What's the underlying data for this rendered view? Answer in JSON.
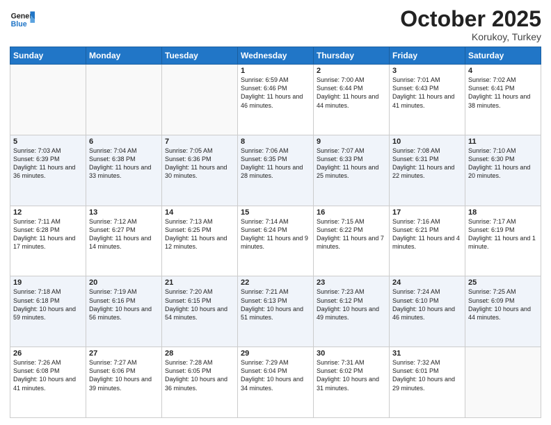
{
  "header": {
    "logo_line1": "General",
    "logo_line2": "Blue",
    "month": "October 2025",
    "location": "Korukoy, Turkey"
  },
  "days_of_week": [
    "Sunday",
    "Monday",
    "Tuesday",
    "Wednesday",
    "Thursday",
    "Friday",
    "Saturday"
  ],
  "weeks": [
    [
      {
        "day": "",
        "info": ""
      },
      {
        "day": "",
        "info": ""
      },
      {
        "day": "",
        "info": ""
      },
      {
        "day": "1",
        "info": "Sunrise: 6:59 AM\nSunset: 6:46 PM\nDaylight: 11 hours\nand 46 minutes."
      },
      {
        "day": "2",
        "info": "Sunrise: 7:00 AM\nSunset: 6:44 PM\nDaylight: 11 hours\nand 44 minutes."
      },
      {
        "day": "3",
        "info": "Sunrise: 7:01 AM\nSunset: 6:43 PM\nDaylight: 11 hours\nand 41 minutes."
      },
      {
        "day": "4",
        "info": "Sunrise: 7:02 AM\nSunset: 6:41 PM\nDaylight: 11 hours\nand 38 minutes."
      }
    ],
    [
      {
        "day": "5",
        "info": "Sunrise: 7:03 AM\nSunset: 6:39 PM\nDaylight: 11 hours\nand 36 minutes."
      },
      {
        "day": "6",
        "info": "Sunrise: 7:04 AM\nSunset: 6:38 PM\nDaylight: 11 hours\nand 33 minutes."
      },
      {
        "day": "7",
        "info": "Sunrise: 7:05 AM\nSunset: 6:36 PM\nDaylight: 11 hours\nand 30 minutes."
      },
      {
        "day": "8",
        "info": "Sunrise: 7:06 AM\nSunset: 6:35 PM\nDaylight: 11 hours\nand 28 minutes."
      },
      {
        "day": "9",
        "info": "Sunrise: 7:07 AM\nSunset: 6:33 PM\nDaylight: 11 hours\nand 25 minutes."
      },
      {
        "day": "10",
        "info": "Sunrise: 7:08 AM\nSunset: 6:31 PM\nDaylight: 11 hours\nand 22 minutes."
      },
      {
        "day": "11",
        "info": "Sunrise: 7:10 AM\nSunset: 6:30 PM\nDaylight: 11 hours\nand 20 minutes."
      }
    ],
    [
      {
        "day": "12",
        "info": "Sunrise: 7:11 AM\nSunset: 6:28 PM\nDaylight: 11 hours\nand 17 minutes."
      },
      {
        "day": "13",
        "info": "Sunrise: 7:12 AM\nSunset: 6:27 PM\nDaylight: 11 hours\nand 14 minutes."
      },
      {
        "day": "14",
        "info": "Sunrise: 7:13 AM\nSunset: 6:25 PM\nDaylight: 11 hours\nand 12 minutes."
      },
      {
        "day": "15",
        "info": "Sunrise: 7:14 AM\nSunset: 6:24 PM\nDaylight: 11 hours\nand 9 minutes."
      },
      {
        "day": "16",
        "info": "Sunrise: 7:15 AM\nSunset: 6:22 PM\nDaylight: 11 hours\nand 7 minutes."
      },
      {
        "day": "17",
        "info": "Sunrise: 7:16 AM\nSunset: 6:21 PM\nDaylight: 11 hours\nand 4 minutes."
      },
      {
        "day": "18",
        "info": "Sunrise: 7:17 AM\nSunset: 6:19 PM\nDaylight: 11 hours\nand 1 minute."
      }
    ],
    [
      {
        "day": "19",
        "info": "Sunrise: 7:18 AM\nSunset: 6:18 PM\nDaylight: 10 hours\nand 59 minutes."
      },
      {
        "day": "20",
        "info": "Sunrise: 7:19 AM\nSunset: 6:16 PM\nDaylight: 10 hours\nand 56 minutes."
      },
      {
        "day": "21",
        "info": "Sunrise: 7:20 AM\nSunset: 6:15 PM\nDaylight: 10 hours\nand 54 minutes."
      },
      {
        "day": "22",
        "info": "Sunrise: 7:21 AM\nSunset: 6:13 PM\nDaylight: 10 hours\nand 51 minutes."
      },
      {
        "day": "23",
        "info": "Sunrise: 7:23 AM\nSunset: 6:12 PM\nDaylight: 10 hours\nand 49 minutes."
      },
      {
        "day": "24",
        "info": "Sunrise: 7:24 AM\nSunset: 6:10 PM\nDaylight: 10 hours\nand 46 minutes."
      },
      {
        "day": "25",
        "info": "Sunrise: 7:25 AM\nSunset: 6:09 PM\nDaylight: 10 hours\nand 44 minutes."
      }
    ],
    [
      {
        "day": "26",
        "info": "Sunrise: 7:26 AM\nSunset: 6:08 PM\nDaylight: 10 hours\nand 41 minutes."
      },
      {
        "day": "27",
        "info": "Sunrise: 7:27 AM\nSunset: 6:06 PM\nDaylight: 10 hours\nand 39 minutes."
      },
      {
        "day": "28",
        "info": "Sunrise: 7:28 AM\nSunset: 6:05 PM\nDaylight: 10 hours\nand 36 minutes."
      },
      {
        "day": "29",
        "info": "Sunrise: 7:29 AM\nSunset: 6:04 PM\nDaylight: 10 hours\nand 34 minutes."
      },
      {
        "day": "30",
        "info": "Sunrise: 7:31 AM\nSunset: 6:02 PM\nDaylight: 10 hours\nand 31 minutes."
      },
      {
        "day": "31",
        "info": "Sunrise: 7:32 AM\nSunset: 6:01 PM\nDaylight: 10 hours\nand 29 minutes."
      },
      {
        "day": "",
        "info": ""
      }
    ]
  ]
}
